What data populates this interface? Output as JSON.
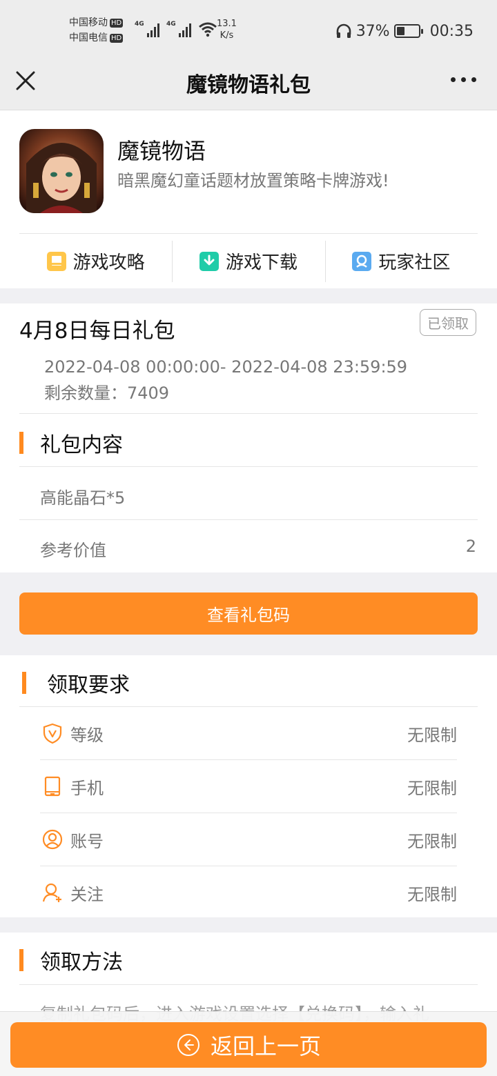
{
  "status_bar": {
    "carrier_1": "中国移动",
    "carrier_2": "中国电信",
    "hd_badge": "HD",
    "net_type": "4G",
    "speed_value": "13.1",
    "speed_unit": "K/s",
    "battery": "37%",
    "battery_level": 0.37,
    "time": "00:35"
  },
  "nav": {
    "title": "魔镜物语礼包"
  },
  "game": {
    "name": "魔镜物语",
    "description": "暗黑魔幻童话题材放置策略卡牌游戏!",
    "links": [
      {
        "label": "游戏攻略",
        "icon": "guide-icon",
        "color": "#ffc64a"
      },
      {
        "label": "游戏下载",
        "icon": "download-icon",
        "color": "#1fcca8"
      },
      {
        "label": "玩家社区",
        "icon": "community-icon",
        "color": "#5aaaf0"
      }
    ]
  },
  "gift": {
    "title": "4月8日每日礼包",
    "status": "已领取",
    "time_range": "2022-04-08 00:00:00- 2022-04-08 23:59:59",
    "remaining": "剩余数量：7409",
    "contents_heading": "礼包内容",
    "item": "高能晶石*5",
    "value_label": "参考价值",
    "value": "2"
  },
  "view_code_button": "查看礼包码",
  "requirements": {
    "heading": "领取要求",
    "rows": [
      {
        "label": "等级",
        "value": "无限制",
        "icon": "level-shield-icon"
      },
      {
        "label": "手机",
        "value": "无限制",
        "icon": "phone-icon"
      },
      {
        "label": "账号",
        "value": "无限制",
        "icon": "account-icon"
      },
      {
        "label": "关注",
        "value": "无限制",
        "icon": "follow-user-icon"
      }
    ]
  },
  "method": {
    "heading": "领取方法",
    "text": "复制礼包码后，进入游戏设置选择【兑换码】，输入礼"
  },
  "back_button": "返回上一页",
  "colors": {
    "accent": "#ff8c24",
    "header_bg": "#ededed",
    "page_bg": "#f0f0f3"
  }
}
